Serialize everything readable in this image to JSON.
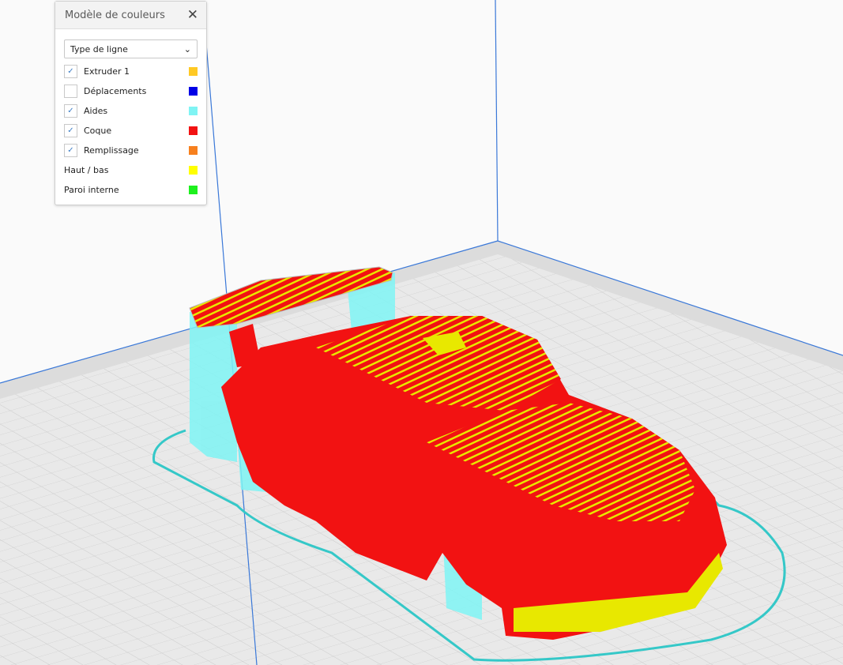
{
  "panel": {
    "title": "Modèle de couleurs",
    "close_icon": "close-icon",
    "color_scheme": "Type de ligne",
    "items": [
      {
        "label": "Extruder 1",
        "checkbox": true,
        "checked": true,
        "color": "#ffc924"
      },
      {
        "label": "Déplacements",
        "checkbox": true,
        "checked": false,
        "color": "#0000e6"
      },
      {
        "label": "Aides",
        "checkbox": true,
        "checked": true,
        "color": "#7ff4f4"
      },
      {
        "label": "Coque",
        "checkbox": true,
        "checked": true,
        "color": "#f21212"
      },
      {
        "label": "Remplissage",
        "checkbox": true,
        "checked": true,
        "color": "#f7801e"
      },
      {
        "label": "Haut / bas",
        "checkbox": false,
        "checked": false,
        "color": "#ffff00"
      },
      {
        "label": "Paroi interne",
        "checkbox": false,
        "checked": false,
        "color": "#1ef01e"
      }
    ]
  }
}
